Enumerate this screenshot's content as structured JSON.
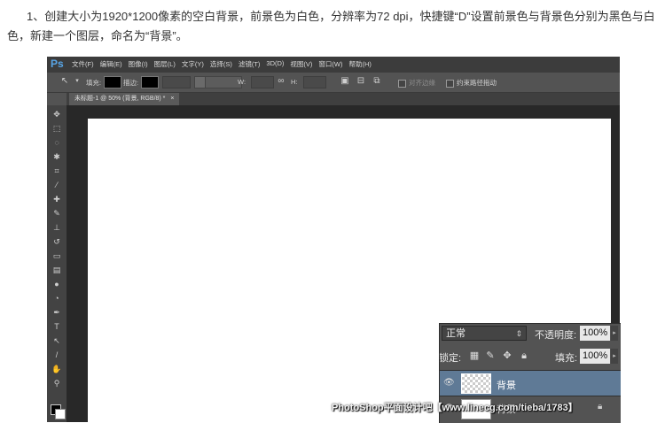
{
  "caption": "1、创建大小为1920*1200像素的空白背景，前景色为白色，分辨率为72 dpi，快捷键“D”设置前景色与背景色分别为黑色与白色，新建一个图层，命名为“背景”。",
  "app": {
    "logo": "Ps",
    "menu": [
      "文件(F)",
      "编辑(E)",
      "图像(I)",
      "图层(L)",
      "文字(Y)",
      "选择(S)",
      "滤镜(T)",
      "3D(D)",
      "视图(V)",
      "窗口(W)",
      "帮助(H)"
    ]
  },
  "options": {
    "fill_label": "填充:",
    "stroke_label": "描边:",
    "w_label": "W:",
    "h_label": "H:",
    "align_edges": "对齐边缘",
    "constrain_path": "约束路径拖动"
  },
  "document_tab": {
    "label": "未标题-1 @ 50% (背景, RGB/8) *",
    "close": "×"
  },
  "layers_panel": {
    "blend_mode": "正常",
    "opacity_label": "不透明度:",
    "opacity_value": "100%",
    "lock_label": "锁定:",
    "fill_label": "填充:",
    "fill_value": "100%",
    "layers": [
      {
        "name": "背景",
        "selected": true,
        "visible": true
      },
      {
        "name": "背景",
        "selected": false,
        "visible": true
      }
    ]
  },
  "watermark": "PhotoShop平面设计吧【www.linecg.com/tieba/1783】",
  "colors": {
    "foreground": "#000000",
    "background": "#ffffff",
    "selection": "#5f7a96"
  }
}
